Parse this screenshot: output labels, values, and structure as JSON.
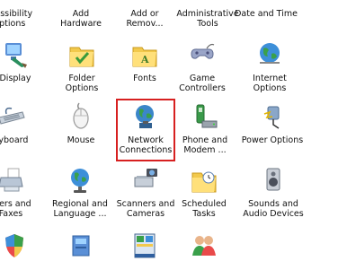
{
  "control_panel": {
    "row0": [
      {
        "label": "ccessibility\nOptions",
        "icon": "accessibility-icon"
      },
      {
        "label": "Add Hardware",
        "icon": "add-hardware-icon"
      },
      {
        "label": "Add or\nRemov...",
        "icon": "add-remove-programs-icon"
      },
      {
        "label": "Administrative\nTools",
        "icon": "administrative-tools-icon"
      },
      {
        "label": "Date and Time",
        "icon": "date-time-icon"
      }
    ],
    "row1": [
      {
        "label": "Display",
        "icon": "display-icon"
      },
      {
        "label": "Folder Options",
        "icon": "folder-options-icon"
      },
      {
        "label": "Fonts",
        "icon": "fonts-folder-icon"
      },
      {
        "label": "Game\nControllers",
        "icon": "game-controller-icon"
      },
      {
        "label": "Internet\nOptions",
        "icon": "internet-options-globe-icon"
      }
    ],
    "row2": [
      {
        "label": "eyboard",
        "icon": "keyboard-icon"
      },
      {
        "label": "Mouse",
        "icon": "mouse-icon"
      },
      {
        "label": "Network\nConnections",
        "icon": "network-connections-icon"
      },
      {
        "label": "Phone and\nModem ...",
        "icon": "phone-modem-icon"
      },
      {
        "label": "Power Options",
        "icon": "power-options-icon"
      }
    ],
    "row3": [
      {
        "label": "nters and\nFaxes",
        "icon": "printers-faxes-icon"
      },
      {
        "label": "Regional and\nLanguage ...",
        "icon": "regional-language-globe-icon"
      },
      {
        "label": "Scanners and\nCameras",
        "icon": "scanners-cameras-icon"
      },
      {
        "label": "Scheduled\nTasks",
        "icon": "scheduled-tasks-folder-icon"
      },
      {
        "label": "Sounds and\nAudio Devices",
        "icon": "sounds-audio-speaker-icon"
      }
    ],
    "row4": [
      {
        "icon": "security-center-icon"
      },
      {
        "icon": "system-icon"
      },
      {
        "icon": "taskbar-start-menu-icon"
      },
      {
        "icon": "user-accounts-icon"
      }
    ],
    "highlighted_item": "Network Connections",
    "highlight_color": "#d72020"
  }
}
